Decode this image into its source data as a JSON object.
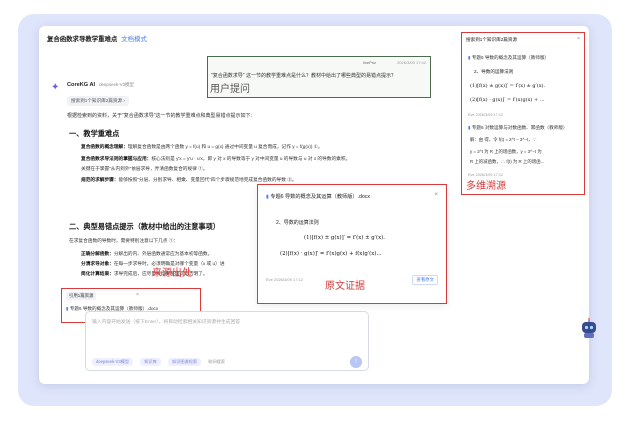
{
  "window": {
    "title": "复合函数求导教学重难点",
    "title_link": "文档模式"
  },
  "user_message": {
    "name": "livePnz",
    "time": "2026/3/09 17:42",
    "question": "\"复合函数求导\" 这一节的教学重难点是什么？教材中给出了哪些典型的易错点提示？",
    "annotation": "用户提问"
  },
  "assistant": {
    "name": "CoreKG AI",
    "model": "deepseek-V3模型",
    "chip": "搜索到1个知识库2篇资源 ›",
    "intro": "根据检索到的资料，关于\"复合函数求导\"这一节的教学重难点和典型易错点提示如下：",
    "section1_title": "一、教学重难点",
    "section1_lines": [
      {
        "label": "复合函数的概念理解：",
        "text": "理解复合函数是由两个函数 y = f(u) 和 u = g(x) 通过中间变量 u 复合而成，记作 y = f(g(x)) ①。"
      },
      {
        "label": "复合函数求导法则的掌握与应用：",
        "text": "核心法则是 y′x = y′u · u′x，即 y 对 x 的导数等于 y 对中间变量 u 的导数与 u 对 x 的导数的乘积。"
      },
      {
        "label": "",
        "text": "关键在于掌握\"从内到外\"依层求导，弄清函数复合的规律 ①。"
      },
      {
        "label": "规范的求解步骤：",
        "text": "能够按照\"分层、分别求导、相乘、变量回代\"四个步骤规范地完成复合函数的导数 ②。"
      }
    ],
    "section2_title": "二、典型易错点提示（教材中给出的注意事项）",
    "section2_intro": "在求复合函数的导数时，需要特别注意以下几点 ①：",
    "section2_lines": [
      {
        "label": "正确分解函数：",
        "text": "分解出的内、外层函数通常应为基本初等函数。"
      },
      {
        "label": "分清求导对象：",
        "text": "在每一步求导时，必须明确是对哪个变量（x 或 u）进"
      },
      {
        "label": "简化计算结果：",
        "text": "求导完成后，应尽量将结果整理得简洁明了。"
      }
    ]
  },
  "source_panel": {
    "header": "引用1篇资源",
    "close": "×",
    "item": "专题6 导数的概念及其运算（教师版）.docx",
    "annotation": "来源出处"
  },
  "input": {
    "placeholder": "输入内容开始发送（按下Enter），将目动检索相关知识资源并生成回答",
    "tool_model": "deepseek-V3模型",
    "tool_kb": "知识库",
    "tool_kg": "知识图谱检索",
    "tool_web": "联网搜索",
    "send_icon": "↑"
  },
  "original_popup": {
    "doc": "专题6 导数的概念及其运算（教师版）.docx",
    "section": "2、导数的运算法则",
    "formula1": "(1)[f(x) ± g(x)]′ = f′(x) ± g′(x).",
    "formula2": "(2)[f(x) · g(x)]′ = f′(x)g(x) + f(x)g′(x)...",
    "footer": "Eve  2026/3/09 17:12",
    "button": "查看原文",
    "annotation": "原文证据"
  },
  "trace_panel": {
    "header": "搜索到1个知识库2篇资源",
    "close": "×",
    "doc1": "专题6 导数的概念及其运算（教师版）",
    "section": "2、导数的运算法则",
    "formula1": "(1)[f(x) ± g(x)]′ = f′(x) ± g′(x).",
    "formula2": "(2)[f(x) · g(x)]′ = f′(x)g(x) + ...",
    "meta1": "Eve                2026/3/09 17:12",
    "doc2": "专题6 对数运算与对数函数、幂函数（教师版）",
    "text1": "解：由 得，令 f(t) = 2^t − 3^−t，∵",
    "text2": "y = 2^t 为 R 上的增函数，y = 3^−t 为",
    "text3": "R 上的减函数，∴ f(t) 为 R 上的增函...",
    "meta2": "Eve                2026/3/09 17:12",
    "annotation": "多维溯源"
  }
}
